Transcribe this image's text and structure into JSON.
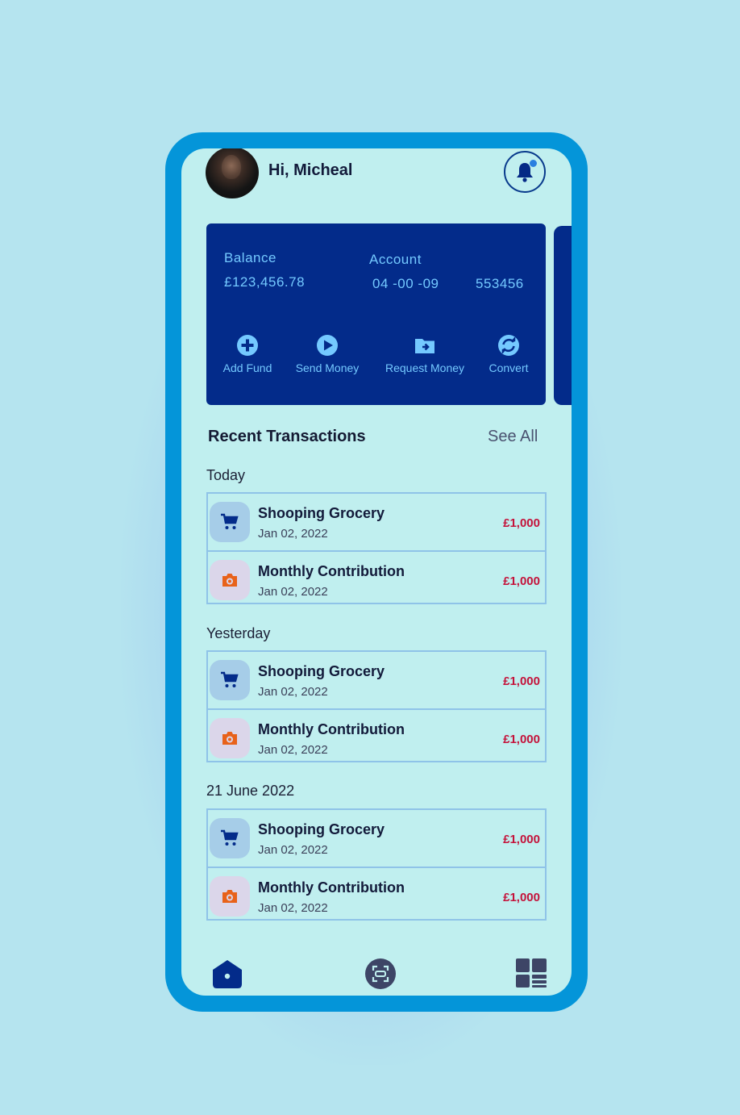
{
  "header": {
    "greeting": "Hi, Micheal"
  },
  "card": {
    "balance_label": "Balance",
    "balance_value": "£123,456.78",
    "account_label": "Account",
    "sort_code": "04 -00 -09",
    "account_number": "553456",
    "actions": [
      {
        "label": "Add Fund",
        "icon": "plus-circle-icon"
      },
      {
        "label": "Send Money",
        "icon": "send-icon"
      },
      {
        "label": "Request Money",
        "icon": "folder-icon"
      },
      {
        "label": "Convert",
        "icon": "convert-icon"
      }
    ]
  },
  "transactions": {
    "title": "Recent Transactions",
    "see_all": "See All",
    "groups": [
      {
        "label": "Today",
        "items": [
          {
            "title": "Shooping Grocery",
            "date": "Jan 02, 2022",
            "amount": "£1,000",
            "icon": "cart-icon"
          },
          {
            "title": "Monthly Contribution",
            "date": "Jan 02, 2022",
            "amount": "£1,000",
            "icon": "camera-icon"
          }
        ]
      },
      {
        "label": "Yesterday",
        "items": [
          {
            "title": "Shooping Grocery",
            "date": "Jan 02, 2022",
            "amount": "£1,000",
            "icon": "cart-icon"
          },
          {
            "title": "Monthly Contribution",
            "date": "Jan 02, 2022",
            "amount": "£1,000",
            "icon": "camera-icon"
          }
        ]
      },
      {
        "label": "21 June 2022",
        "items": [
          {
            "title": "Shooping Grocery",
            "date": "Jan 02, 2022",
            "amount": "£1,000",
            "icon": "cart-icon"
          },
          {
            "title": "Monthly Contribution",
            "date": "Jan 02, 2022",
            "amount": "£1,000",
            "icon": "camera-icon"
          }
        ]
      }
    ]
  },
  "nav": [
    "home-icon",
    "scan-icon",
    "dashboard-icon"
  ],
  "colors": {
    "card": "#032b8a",
    "frame": "#0495d9",
    "screen": "#c0efef",
    "amount": "#c4123a"
  }
}
